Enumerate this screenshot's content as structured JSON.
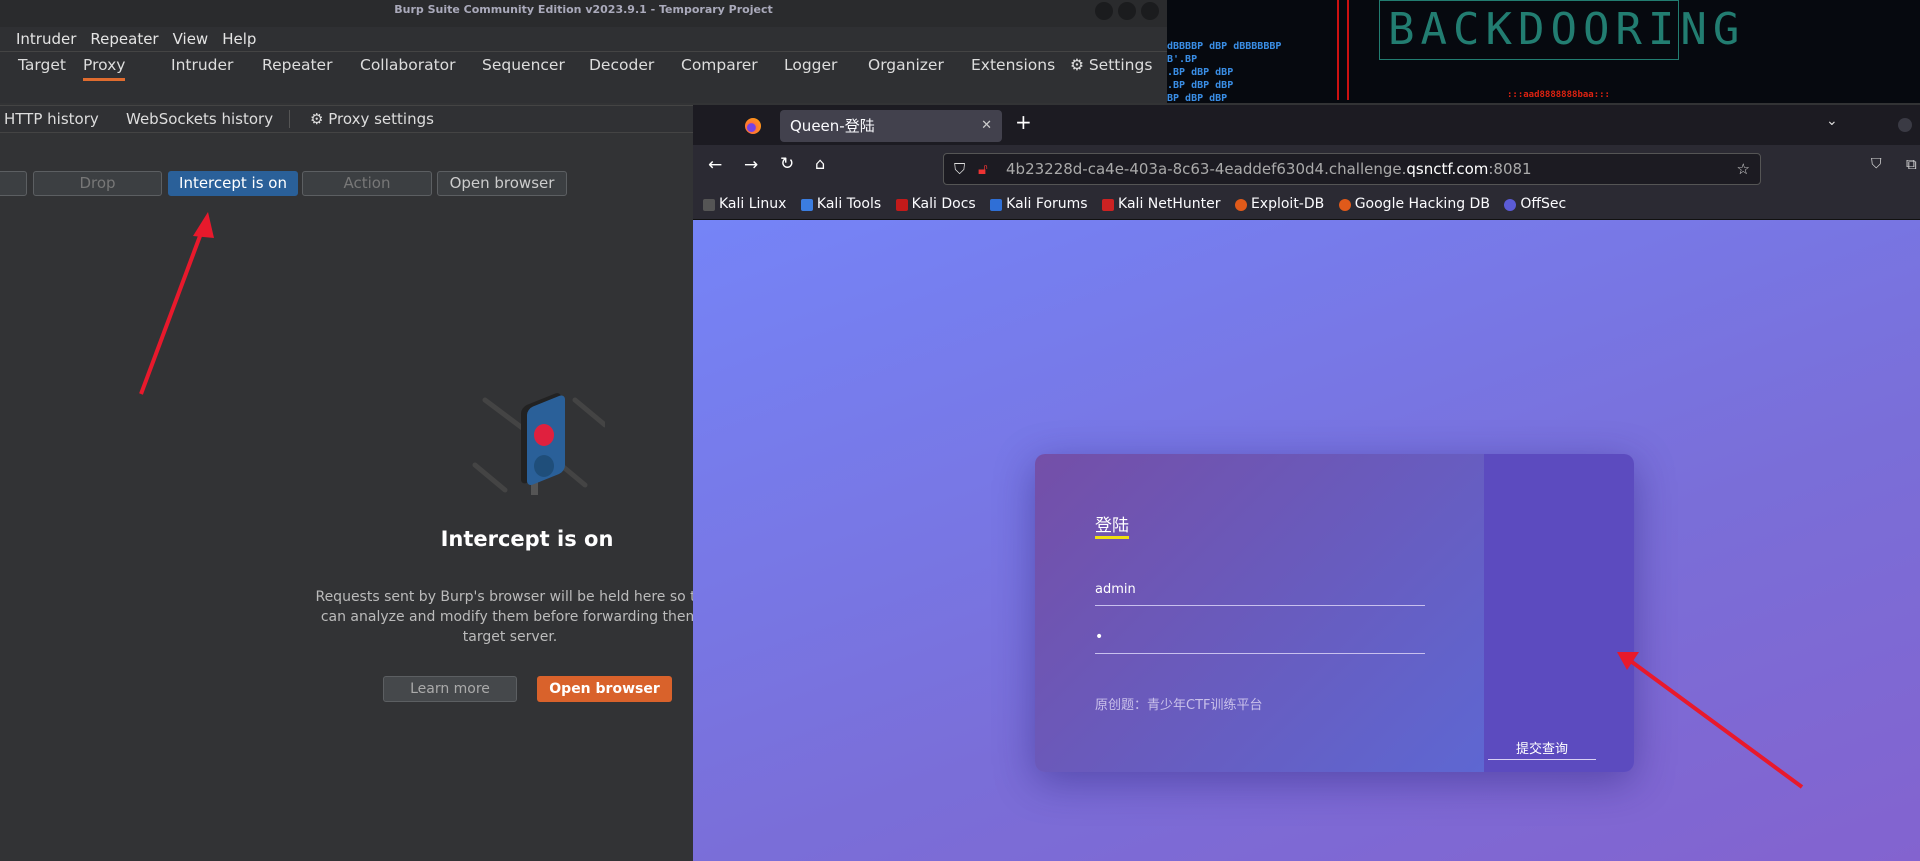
{
  "burp": {
    "title": "Burp Suite Community Edition v2023.9.1 - Temporary Project",
    "menu": [
      "Intruder",
      "Repeater",
      "View",
      "Help"
    ],
    "tabs": [
      "Target",
      "Proxy",
      "Intruder",
      "Repeater",
      "Collaborator",
      "Sequencer",
      "Decoder",
      "Comparer",
      "Logger",
      "Organizer",
      "Extensions",
      "Settings"
    ],
    "active_tab": "Proxy",
    "subtabs": [
      "HTTP history",
      "WebSockets history",
      "Proxy settings"
    ],
    "toolbar": {
      "drop": "Drop",
      "intercept": "Intercept is on",
      "action": "Action",
      "open_browser": "Open browser"
    },
    "empty": {
      "heading": "Intercept is on",
      "line1": "Requests sent by Burp's browser will be held here so th",
      "line2": "can analyze and modify them before forwarding them",
      "line3": "target server.",
      "learn_more": "Learn more",
      "open_browser": "Open browser"
    }
  },
  "terminal": {
    "lines": [
      "dBBBBP dBP dBBBBBBP",
      "B'.BP",
      ".BP dBP    dBP",
      ".BP dBP    dBP",
      "BP dBP    dBP"
    ],
    "banner": "BACKDOORING",
    "red": ":::aad8888888baa:::"
  },
  "firefox": {
    "tab_title": "Queen-登陆",
    "url_prefix": "4b23228d-ca4e-403a-8c63-4eaddef630d4.challenge.",
    "url_domain": "qsnctf.com",
    "url_port": ":8081",
    "bookmarks": [
      "Kali Linux",
      "Kali Tools",
      "Kali Docs",
      "Kali Forums",
      "Kali NetHunter",
      "Exploit-DB",
      "Google Hacking DB",
      "OffSec"
    ],
    "bookmark_colors": [
      "#333",
      "#3b7de0",
      "#c21a1a",
      "#2f6fd6",
      "#c22",
      "#e05a1a",
      "#e05a1a",
      "#5b5bd6"
    ]
  },
  "login": {
    "title": "登陆",
    "username": "admin",
    "password": "•",
    "footer": "原创题：青少年CTF训练平台",
    "submit": "提交查询"
  },
  "colors": {
    "accent": "#e06c2f",
    "intercept_btn": "#2a6099",
    "arrow": "#e8192c",
    "title_underline": "#f0e010"
  }
}
